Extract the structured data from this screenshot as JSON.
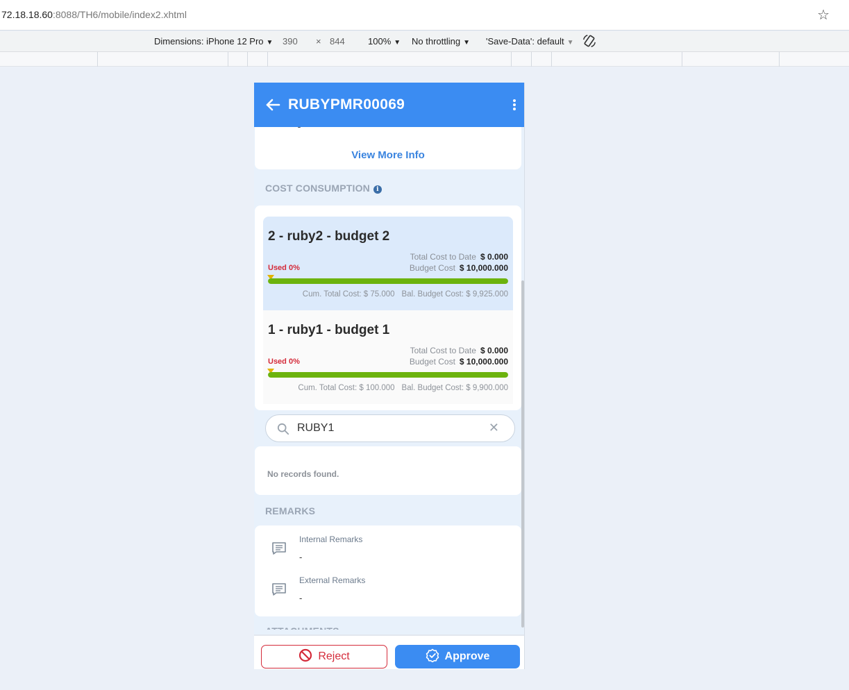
{
  "browser": {
    "url_host": "72.18.18.60",
    "url_rest": ":8088/TH6/mobile/index2.xhtml",
    "devtools": {
      "dimensions_label": "Dimensions: iPhone 12 Pro",
      "width": "390",
      "times": "×",
      "height": "844",
      "zoom": "100%",
      "throttling": "No throttling",
      "save_data": "'Save-Data': default"
    }
  },
  "app": {
    "title": "RUBYPMR00069",
    "view_more": "View More Info",
    "cost_section_title": "COST CONSUMPTION",
    "info_glyph": "i",
    "budgets": [
      {
        "name": "2 - ruby2 - budget 2",
        "total_cost_label": "Total Cost to Date",
        "total_cost_value": "$ 0.000",
        "budget_cost_label": "Budget Cost",
        "budget_cost_value": "$ 10,000.000",
        "used_label": "Used 0%",
        "used_fraction": 0,
        "cum_total": "Cum. Total Cost: $ 75.000",
        "bal_budget": "Bal. Budget Cost: $ 9,925.000"
      },
      {
        "name": "1 - ruby1 - budget 1",
        "total_cost_label": "Total Cost to Date",
        "total_cost_value": "$ 0.000",
        "budget_cost_label": "Budget Cost",
        "budget_cost_value": "$ 10,000.000",
        "used_label": "Used 0%",
        "used_fraction": 0,
        "cum_total": "Cum. Total Cost: $ 100.000",
        "bal_budget": "Bal. Budget Cost: $ 9,900.000"
      }
    ],
    "search_value": "RUBY1",
    "clear_glyph": "✕",
    "no_records": "No records found.",
    "remarks_title": "REMARKS",
    "remarks": [
      {
        "label": "Internal Remarks",
        "value": "-"
      },
      {
        "label": "External Remarks",
        "value": "-"
      }
    ],
    "attachments_title": "ATTACHMENTS",
    "reject_label": "Reject",
    "approve_label": "Approve",
    "colors": {
      "primary": "#3b8cf2",
      "danger": "#d42b3a",
      "progress": "#6cb30e",
      "marker": "#e2b400"
    }
  }
}
